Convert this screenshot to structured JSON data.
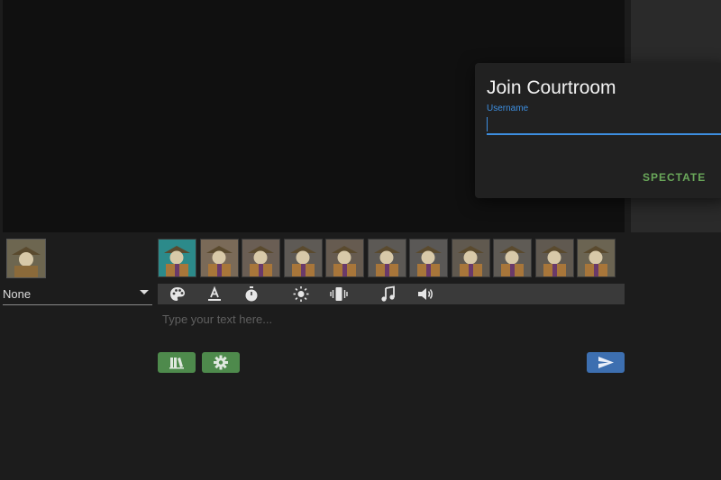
{
  "join_dialog": {
    "title": "Join Courtroom",
    "username_label": "Username",
    "username_value": "",
    "spectate_label": "SPECTATE"
  },
  "character_select": {
    "selected": "None"
  },
  "emotes": {
    "count": 11,
    "selected_index": 0
  },
  "toolbar": {
    "icons": [
      "palette-icon",
      "text-color-icon",
      "timer-icon",
      "brightness-icon",
      "vibrate-icon",
      "music-note-icon",
      "volume-icon"
    ]
  },
  "chat": {
    "placeholder": "Type your text here..."
  },
  "colors": {
    "accent_blue": "#3d8ee0",
    "accent_green": "#6aa85a",
    "button_green": "#4e8a4c",
    "button_blue": "#3d6fb0",
    "selected_emote": "#2c8a8a"
  }
}
